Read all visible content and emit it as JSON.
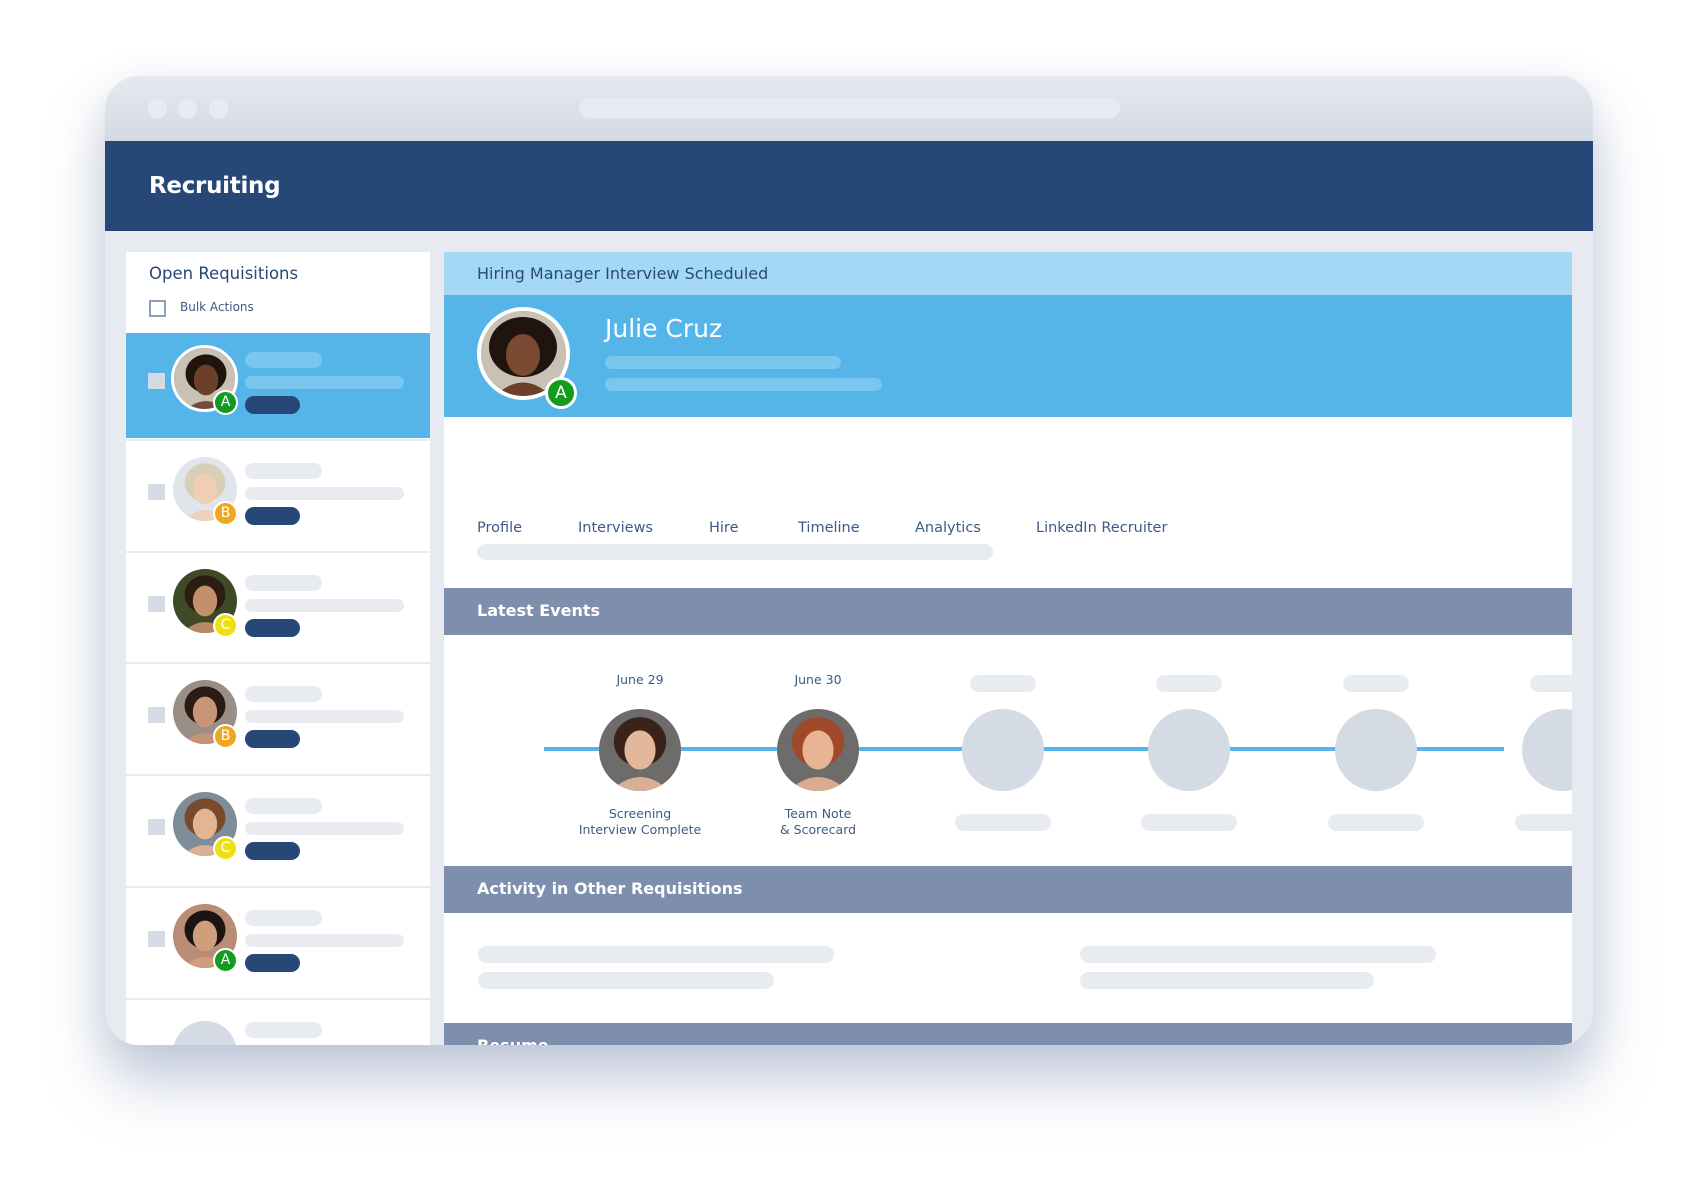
{
  "app": {
    "title": "Recruiting"
  },
  "sidebar": {
    "title": "Open Requisitions",
    "bulk_actions_label": "Bulk Actions",
    "candidates": [
      {
        "grade": "A",
        "badge_color": "#119b1f",
        "selected": true,
        "skin": "#6b3f2a",
        "hair": "#1f140e",
        "bg": "#c9c2b4"
      },
      {
        "grade": "B",
        "badge_color": "#efa81c",
        "selected": false,
        "skin": "#f1cdb4",
        "hair": "#d9ceb8",
        "bg": "#dfe5ea"
      },
      {
        "grade": "C",
        "badge_color": "#f0df0f",
        "selected": false,
        "skin": "#c48f6b",
        "hair": "#2b1d14",
        "bg": "#3d4a25"
      },
      {
        "grade": "B",
        "badge_color": "#efa81c",
        "selected": false,
        "skin": "#c89577",
        "hair": "#2a1c15",
        "bg": "#9b8e84"
      },
      {
        "grade": "C",
        "badge_color": "#f0df0f",
        "selected": false,
        "skin": "#e4b593",
        "hair": "#7a4a2c",
        "bg": "#7f8d9b"
      },
      {
        "grade": "A",
        "badge_color": "#119b1f",
        "selected": false,
        "skin": "#d19e7c",
        "hair": "#1a1412",
        "bg": "#b98c76"
      }
    ]
  },
  "candidate": {
    "status": "Hiring Manager Interview Scheduled",
    "name": "Julie Cruz",
    "grade": "A"
  },
  "tabs": [
    {
      "label": "Profile"
    },
    {
      "label": "Interviews"
    },
    {
      "label": "Hire"
    },
    {
      "label": "Timeline"
    },
    {
      "label": "Analytics"
    },
    {
      "label": "LinkedIn Recruiter"
    }
  ],
  "sections": {
    "latest_events": "Latest Events",
    "activity": "Activity in Other Requisitions",
    "resume": "Resume"
  },
  "events": [
    {
      "date": "June 29",
      "label_line1": "Screening",
      "label_line2": "Interview Complete",
      "has_photo": true,
      "skin": "#e3b79b",
      "hair": "#3a2318"
    },
    {
      "date": "June 30",
      "label_line1": "Team Note",
      "label_line2": "& Scorecard",
      "has_photo": true,
      "skin": "#e7b495",
      "hair": "#a0482a"
    },
    {
      "date": null,
      "label_line1": null,
      "label_line2": null,
      "has_photo": false
    },
    {
      "date": null,
      "label_line1": null,
      "label_line2": null,
      "has_photo": false
    },
    {
      "date": null,
      "label_line1": null,
      "label_line2": null,
      "has_photo": false
    },
    {
      "date": null,
      "label_line1": null,
      "label_line2": null,
      "has_photo": false
    }
  ],
  "colors": {
    "header": "#274776",
    "accent": "#55b5e8",
    "banner": "#a3d9f4",
    "section": "#7d8fad",
    "grade_a": "#119b1f",
    "grade_b": "#efa81c",
    "grade_c": "#f0df0f"
  }
}
